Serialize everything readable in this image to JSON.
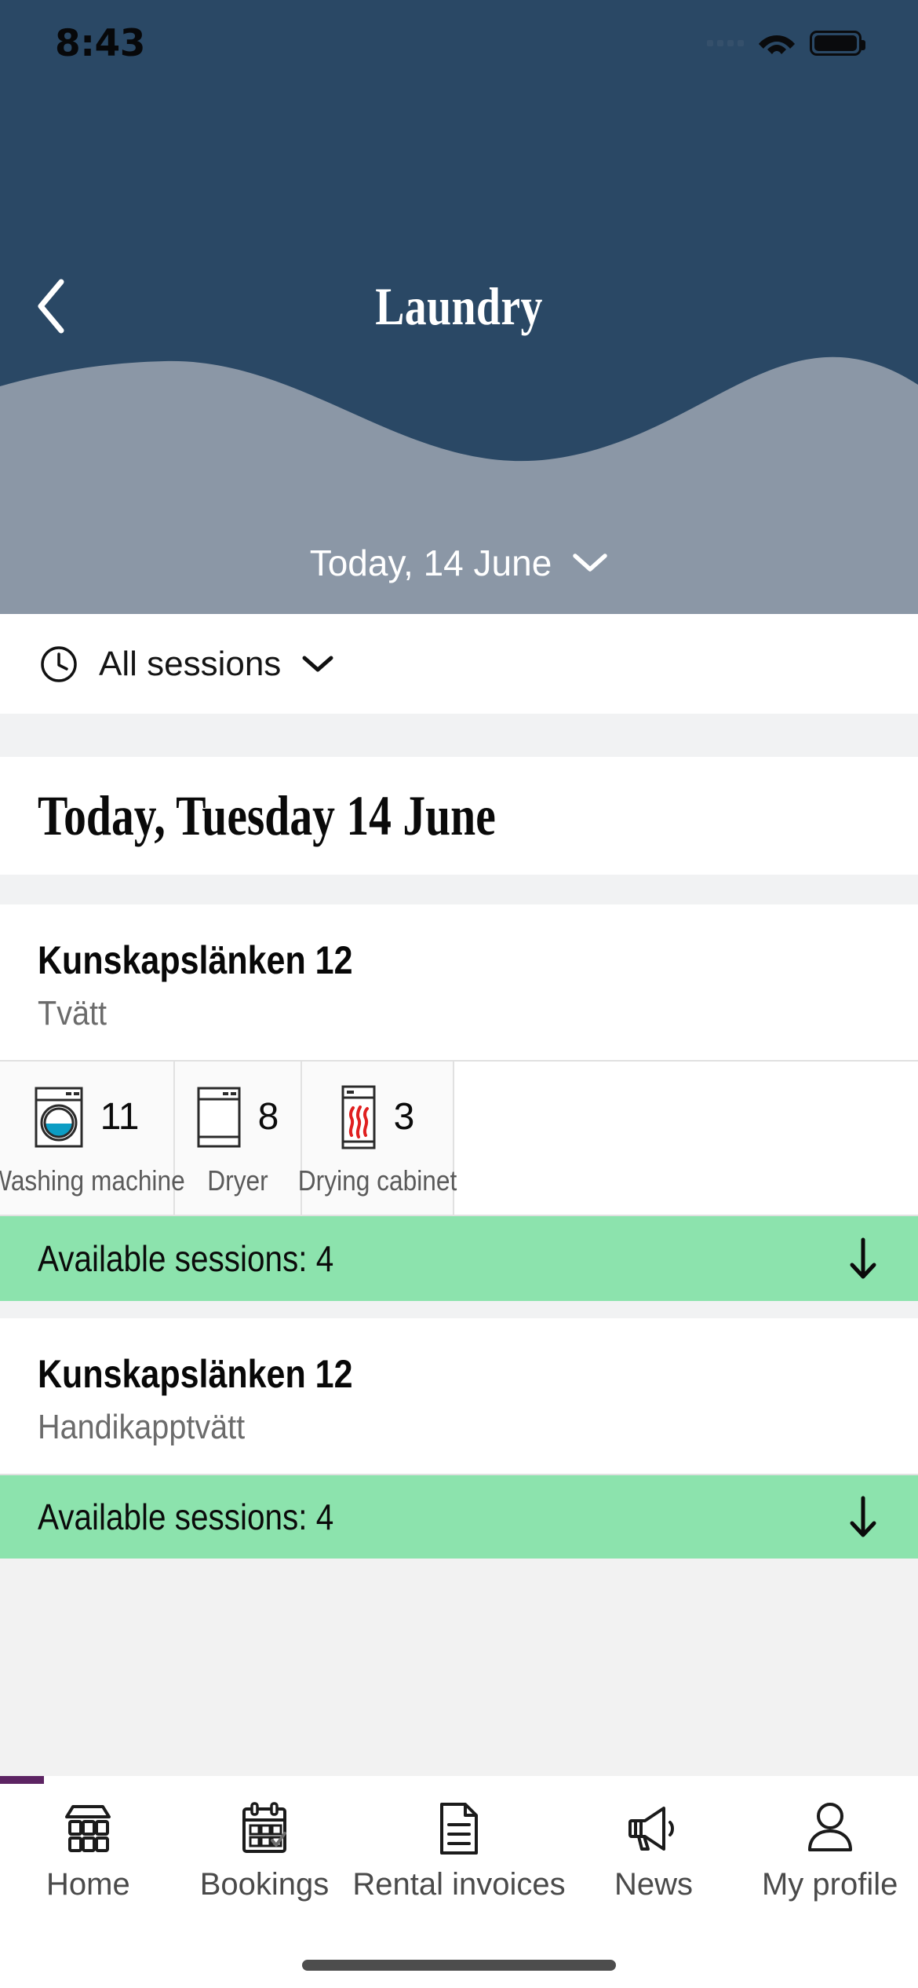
{
  "status_bar": {
    "time": "8:43",
    "wifi_icon": "wifi-icon",
    "battery_icon": "battery-icon"
  },
  "header": {
    "back_icon": "chevron-left-icon",
    "title": "Laundry",
    "date_selector": {
      "label": "Today, 14 June",
      "chevron_icon": "chevron-down-icon"
    },
    "bg_dark": "#2a4865",
    "bg_light": "#8b97a6"
  },
  "filter": {
    "clock_icon": "clock-icon",
    "label": "All sessions",
    "chevron_icon": "chevron-down-icon"
  },
  "day_heading": "Today, Tuesday 14 June",
  "cards": [
    {
      "title": "Kunskapslänken 12",
      "subtitle": "Tvätt",
      "machines": [
        {
          "icon": "washing-machine-icon",
          "count": "11",
          "label": "Washing machine"
        },
        {
          "icon": "dryer-icon",
          "count": "8",
          "label": "Dryer"
        },
        {
          "icon": "drying-cabinet-icon",
          "count": "3",
          "label": "Drying cabinet"
        }
      ],
      "availability": {
        "label": "Available sessions: 4",
        "arrow_icon": "arrow-down-icon",
        "color": "#8ce3ad"
      }
    },
    {
      "title": "Kunskapslänken 12",
      "subtitle": "Handikapptvätt",
      "machines": [],
      "availability": {
        "label": "Available sessions: 4",
        "arrow_icon": "arrow-down-icon",
        "color": "#8ce3ad"
      }
    }
  ],
  "tabbar": {
    "indicator_color": "#5d2463",
    "items": [
      {
        "icon": "building-icon",
        "label": "Home"
      },
      {
        "icon": "calendar-check-icon",
        "label": "Bookings"
      },
      {
        "icon": "document-icon",
        "label": "Rental invoices"
      },
      {
        "icon": "megaphone-icon",
        "label": "News"
      },
      {
        "icon": "person-icon",
        "label": "My profile"
      }
    ]
  }
}
